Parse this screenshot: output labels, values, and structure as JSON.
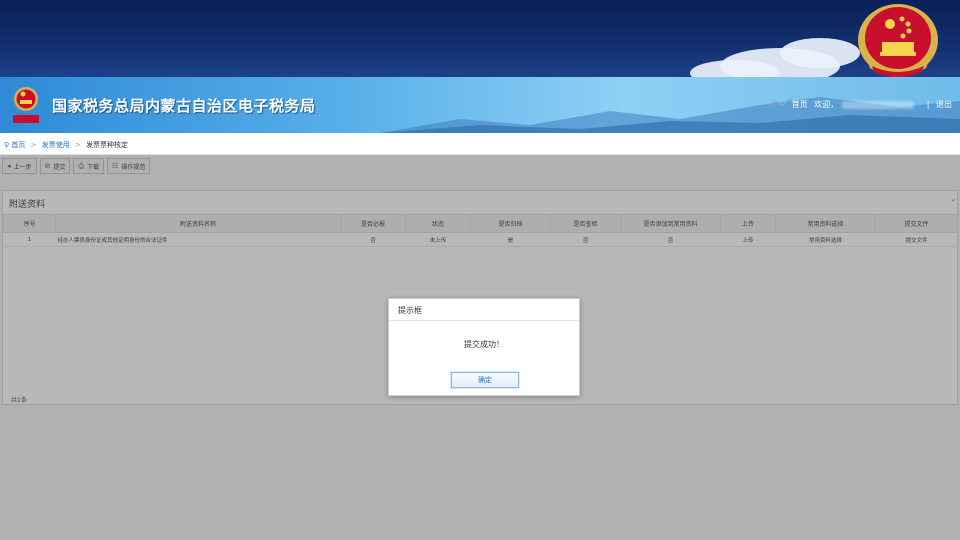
{
  "header": {
    "site_title": "国家税务总局内蒙古自治区电子税务局",
    "links": {
      "home": "首页",
      "welcome": "欢迎，",
      "separator": "|",
      "logout": "退出"
    },
    "emblem_icon": "national-emblem-icon",
    "tax_badge_icon": "tax-badge-icon"
  },
  "breadcrumb": {
    "home": "首页",
    "sep": ">",
    "level1": "发票使用",
    "level2": "发票票种核定"
  },
  "toolbar": {
    "prev": "上一步",
    "submit": "提交",
    "download": "下载",
    "guide": "操作规范"
  },
  "panel": {
    "title": "附送资料",
    "columns": [
      "序号",
      "附送资料名称",
      "是否必报",
      "状态",
      "是否归档",
      "是否查验",
      "是否添加到常用资料",
      "上传",
      "常用资料选择",
      "提交文件"
    ],
    "rows": [
      [
        "1",
        "经办人票员身份证或其他证明身份的合法证件",
        "否",
        "未上传",
        "是",
        "否",
        "否",
        "上传",
        "常用资料选择",
        "提交文件"
      ]
    ],
    "total": "共1条"
  },
  "dialog": {
    "title": "提示框",
    "message": "提交成功！",
    "ok_label": "确定"
  },
  "colors": {
    "top_band": "#13306f",
    "banner": "#55aee8",
    "link": "#2a6fc9"
  }
}
